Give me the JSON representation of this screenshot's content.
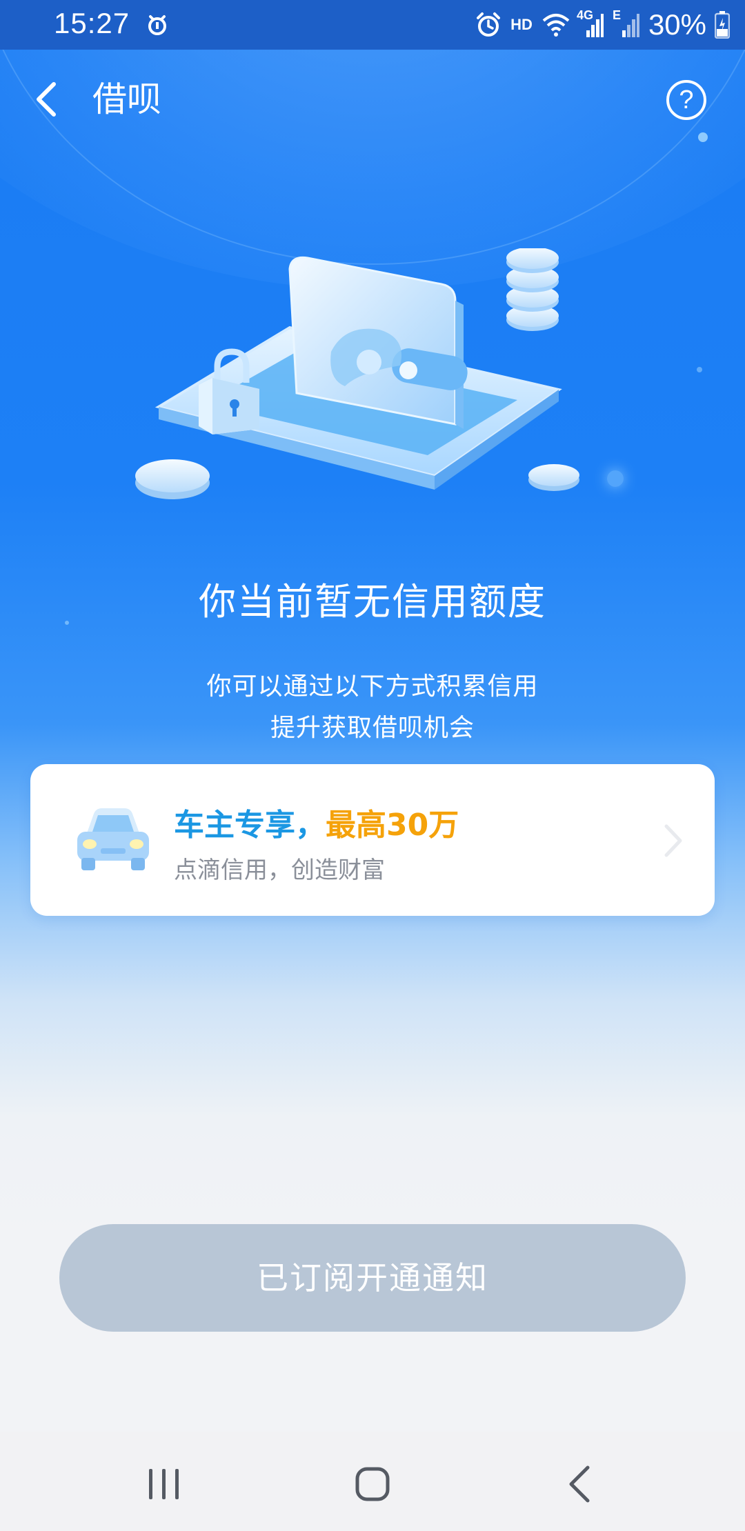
{
  "status_bar": {
    "time": "15:27",
    "hd_label": "HD",
    "network_4g": "4G",
    "network_e": "E",
    "battery": "30%"
  },
  "header": {
    "title": "借呗",
    "help_label": "?"
  },
  "main": {
    "title": "你当前暂无信用额度",
    "subtitle_line1": "你可以通过以下方式积累信用",
    "subtitle_line2": "提升获取借呗机会"
  },
  "promo_card": {
    "title_part1": "车主专享，",
    "title_part2": "最高30万",
    "description": "点滴信用，创造财富"
  },
  "subscribe_button": {
    "label": "已订阅开通通知"
  },
  "colors": {
    "brand_blue": "#1a7bf2",
    "promo_blue": "#1b97e3",
    "promo_orange": "#f5a20a",
    "button_disabled": "#b8c6d6"
  },
  "icons": [
    "notification-icon",
    "alarm-icon",
    "wifi-icon",
    "signal-icon",
    "battery-icon",
    "back-icon",
    "help-icon",
    "car-icon",
    "chevron-right-icon",
    "recent-apps-icon",
    "home-icon",
    "nav-back-icon"
  ]
}
